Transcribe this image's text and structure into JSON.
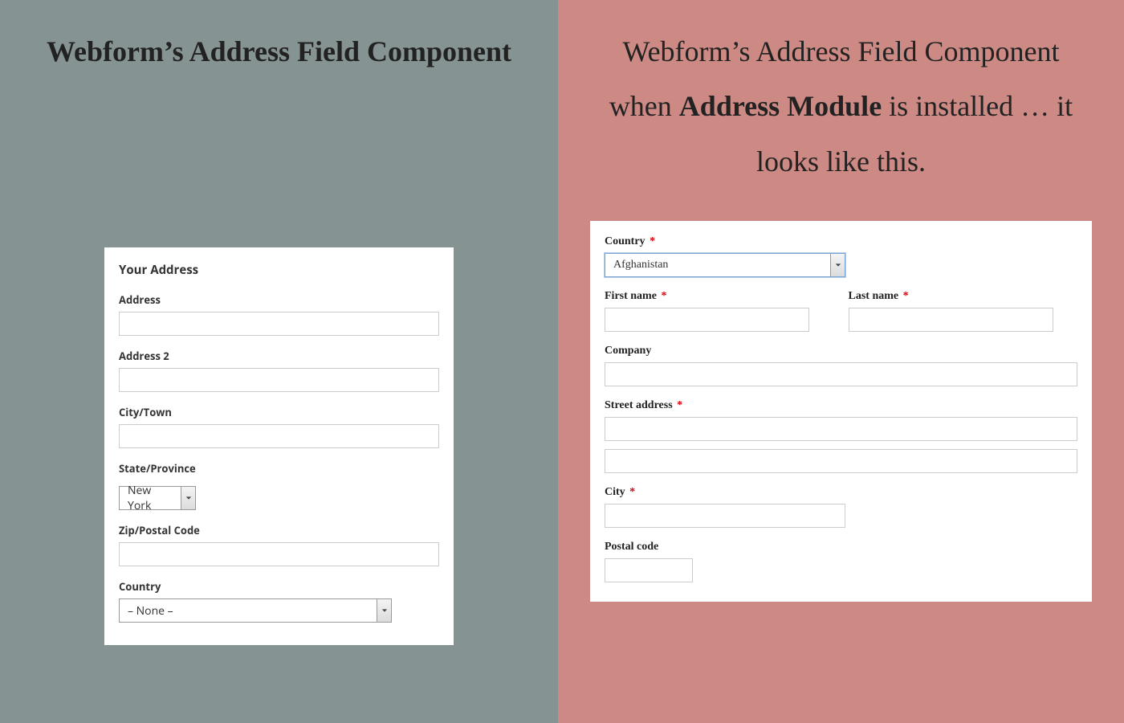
{
  "left": {
    "headline": "Webform’s Address Field Component",
    "form": {
      "title": "Your Address",
      "address_label": "Address",
      "address2_label": "Address 2",
      "city_label": "City/Town",
      "state_label": "State/Province",
      "state_value": "New York",
      "zip_label": "Zip/Postal Code",
      "country_label": "Country",
      "country_value": "– None –"
    }
  },
  "right": {
    "headline_prefix": "Webform’s Address Field Component when ",
    "headline_bold": "Address Module",
    "headline_suffix": " is installed … it looks like this.",
    "form": {
      "country_label": "Country",
      "country_value": "Afghanistan",
      "firstname_label": "First name",
      "lastname_label": "Last name",
      "company_label": "Company",
      "street_label": "Street address",
      "city_label": "City",
      "postal_label": "Postal code"
    }
  }
}
